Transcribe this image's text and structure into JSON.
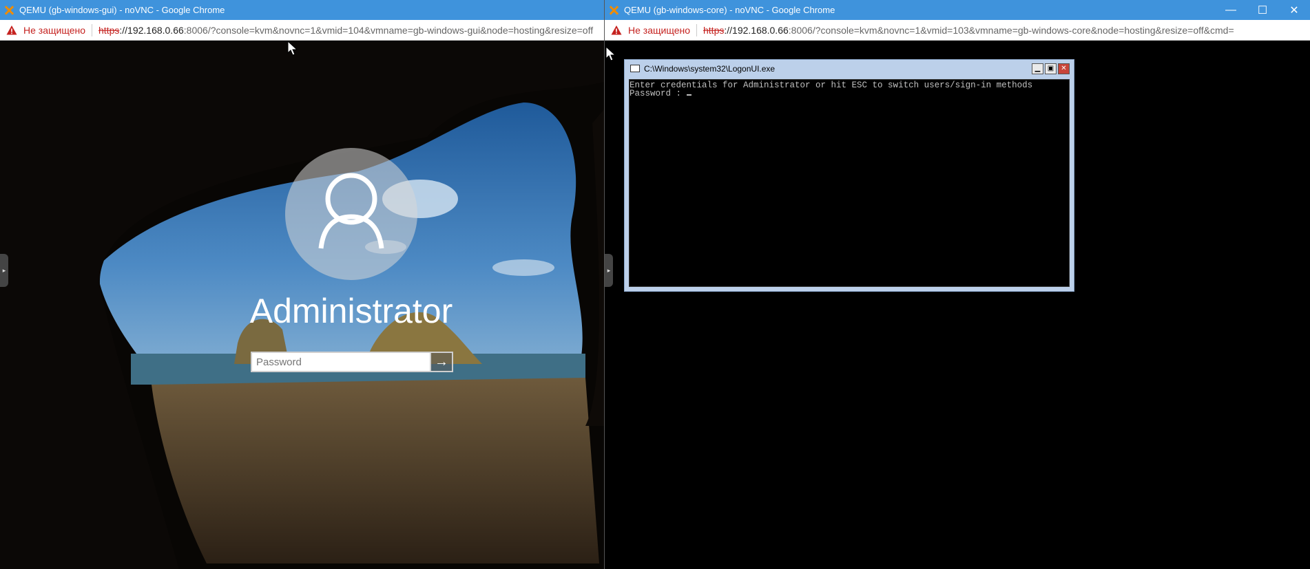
{
  "left_window": {
    "title": "QEMU (gb-windows-gui) - noVNC - Google Chrome",
    "security_label": "Не защищено",
    "url_scheme": "https",
    "url_host": "://192.168.0.66",
    "url_rest": ":8006/?console=kvm&novnc=1&vmid=104&vmname=gb-windows-gui&node=hosting&resize=off",
    "lock_screen": {
      "user_name": "Administrator",
      "password_placeholder": "Password",
      "password_value": "",
      "submit_glyph": "→"
    }
  },
  "right_window": {
    "title": "QEMU (gb-windows-core) - noVNC - Google Chrome",
    "security_label": "Не защищено",
    "url_scheme": "https",
    "url_host": "://192.168.0.66",
    "url_rest": ":8006/?console=kvm&novnc=1&vmid=103&vmname=gb-windows-core&node=hosting&resize=off&cmd=",
    "window_controls": {
      "minimize": "—",
      "maximize": "☐",
      "close": "✕"
    },
    "console": {
      "title": "C:\\Windows\\system32\\LogonUI.exe",
      "line1": "Enter credentials for Administrator or hit ESC to switch users/sign-in methods",
      "line2": "Password : "
    }
  },
  "colors": {
    "titlebar": "#3f93dc",
    "security_warning": "#c5221f",
    "console_frame": "#bcd0ea"
  },
  "icons": [
    "proxmox-x-icon",
    "warning-icon",
    "user-icon",
    "arrow-right-icon",
    "sidebar-handle-icon",
    "console-app-icon",
    "mouse-pointer-icon"
  ]
}
